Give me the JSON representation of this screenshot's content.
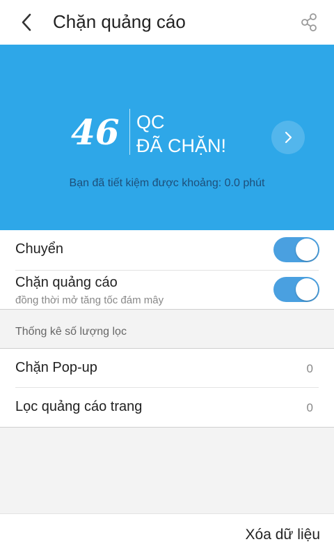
{
  "header": {
    "title": "Chặn quảng cáo",
    "back_icon": "chevron-left-icon",
    "share_icon": "share-icon"
  },
  "banner": {
    "count": "46",
    "qc_label": "QC",
    "blocked_label": "ĐÃ CHẶN!",
    "saved_text": "Bạn đã tiết kiệm được khoảng: 0.0 phút",
    "detail_icon": "chevron-right-icon",
    "background_color": "#2ea7e8"
  },
  "settings": {
    "switch_label": "Chuyển",
    "switch_on": true,
    "adblock_label": "Chặn quảng cáo",
    "adblock_sub": "đồng thời mở tăng tốc đám mây",
    "adblock_on": true,
    "toggle_color": "#4aa0e0"
  },
  "stats": {
    "section_title": "Thống kê số lượng lọc",
    "rows": [
      {
        "label": "Chặn Pop-up",
        "value": "0"
      },
      {
        "label": "Lọc quảng cáo trang",
        "value": "0"
      }
    ]
  },
  "footer": {
    "clear_label": "Xóa dữ liệu"
  }
}
